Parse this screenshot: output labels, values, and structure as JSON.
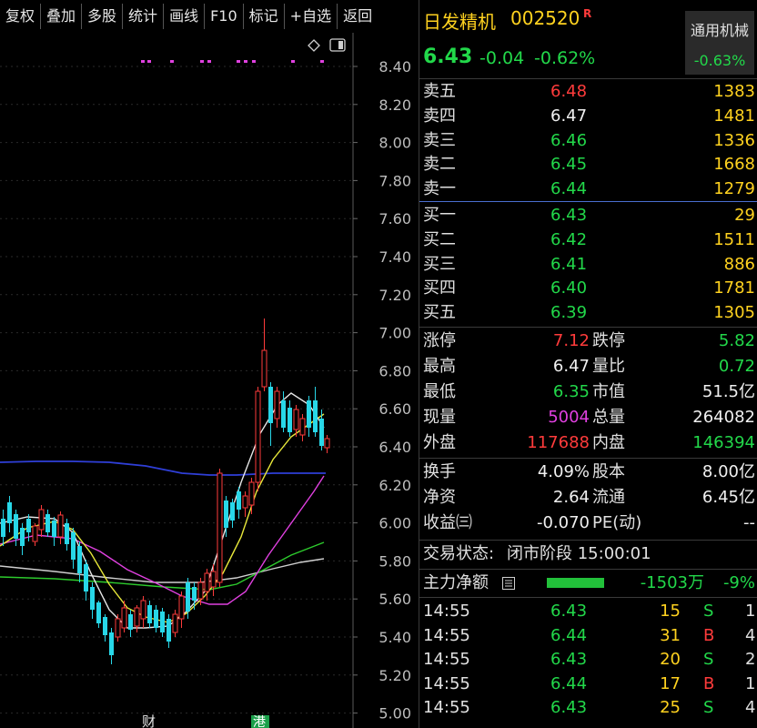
{
  "toolbar": {
    "buttons": [
      "复权",
      "叠加",
      "多股",
      "统计",
      "画线",
      "F10",
      "标记",
      "+自选",
      "返回"
    ]
  },
  "chart": {
    "y_ticks": [
      "8.40",
      "8.20",
      "8.00",
      "7.80",
      "7.60",
      "7.40",
      "7.20",
      "7.00",
      "6.80",
      "6.60",
      "6.40",
      "6.20",
      "6.00",
      "5.80",
      "5.60",
      "5.40",
      "5.20",
      "5.00"
    ],
    "markers": [
      "财",
      "港"
    ],
    "icons": [
      "diamond-icon",
      "panel-toggle-icon"
    ]
  },
  "stock": {
    "name": "日发精机",
    "code": "002520",
    "flag": "R",
    "price": "6.43",
    "change": "-0.04",
    "change_pct": "-0.62%",
    "sector": "通用机械",
    "sector_pct": "-0.63%"
  },
  "asks": [
    {
      "label": "卖五",
      "price": "6.48",
      "vol": "1383"
    },
    {
      "label": "卖四",
      "price": "6.47",
      "vol": "1481"
    },
    {
      "label": "卖三",
      "price": "6.46",
      "vol": "1336"
    },
    {
      "label": "卖二",
      "price": "6.45",
      "vol": "1668"
    },
    {
      "label": "卖一",
      "price": "6.44",
      "vol": "1279"
    }
  ],
  "bids": [
    {
      "label": "买一",
      "price": "6.43",
      "vol": "29"
    },
    {
      "label": "买二",
      "price": "6.42",
      "vol": "1511"
    },
    {
      "label": "买三",
      "price": "6.41",
      "vol": "886"
    },
    {
      "label": "买四",
      "price": "6.40",
      "vol": "1781"
    },
    {
      "label": "买五",
      "price": "6.39",
      "vol": "1305"
    }
  ],
  "stats": {
    "zt_label": "涨停",
    "zt": "7.12",
    "dt_label": "跌停",
    "dt": "5.82",
    "high_label": "最高",
    "high": "6.47",
    "lb_label": "量比",
    "lb": "0.72",
    "low_label": "最低",
    "low": "6.35",
    "mv_label": "市值",
    "mv": "51.5亿",
    "xl_label": "现量",
    "xl": "5004",
    "zl_label": "总量",
    "zl": "264082",
    "wp_label": "外盘",
    "wp": "117688",
    "np_label": "内盘",
    "np": "146394"
  },
  "fundamentals": {
    "hs_label": "换手",
    "hs": "4.09%",
    "gb_label": "股本",
    "gb": "8.00亿",
    "jz_label": "净资",
    "jz": "2.64",
    "lt_label": "流通",
    "lt": "6.45亿",
    "sy_label": "收益㈢",
    "sy": "-0.070",
    "pe_label": "PE(动)",
    "pe": "--"
  },
  "status": {
    "label": "交易状态:",
    "value": "闭市阶段 15:00:01"
  },
  "main_flow": {
    "label": "主力净额",
    "value": "-1503万",
    "pct": "-9%",
    "bar_fraction": 0.09
  },
  "trades": [
    {
      "time": "14:55",
      "price": "6.43",
      "vol": "15",
      "side": "S",
      "n": "1"
    },
    {
      "time": "14:55",
      "price": "6.44",
      "vol": "31",
      "side": "B",
      "n": "4"
    },
    {
      "time": "14:55",
      "price": "6.43",
      "vol": "20",
      "side": "S",
      "n": "2"
    },
    {
      "time": "14:55",
      "price": "6.44",
      "vol": "17",
      "side": "B",
      "n": "1"
    },
    {
      "time": "14:55",
      "price": "6.43",
      "vol": "25",
      "side": "S",
      "n": "4"
    }
  ],
  "colors": {
    "up": "#ff3b3b",
    "down": "#22d84a",
    "flat": "#f0f0f0",
    "accent_yellow": "#ffd21f",
    "magenta": "#e040e0",
    "cyan": "#28d7e8"
  }
}
